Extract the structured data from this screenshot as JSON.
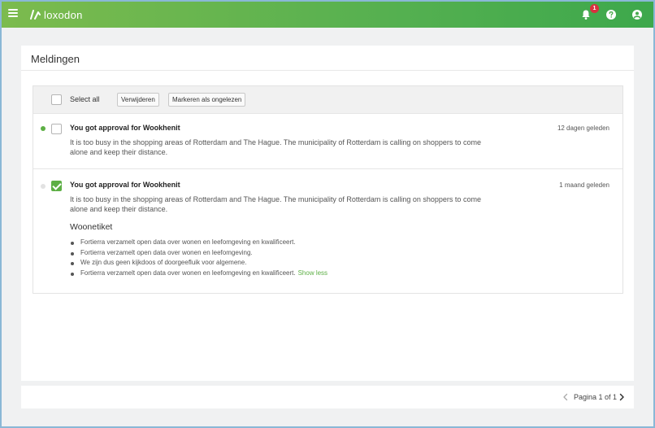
{
  "app": {
    "logo_text": "loxodon"
  },
  "topbar": {
    "notification_count": "1",
    "icons": [
      "menu-icon",
      "bell-icon",
      "help-icon",
      "user-icon"
    ]
  },
  "page": {
    "title": "Meldingen"
  },
  "toolbar": {
    "select_all_label": "Select all",
    "delete_label": "Verwijderen",
    "mark_unread_label": "Markeren als ongelezen"
  },
  "notifications": [
    {
      "read": false,
      "selected": false,
      "title": "You got approval for Wookhenit",
      "body": "It is too busy in the shopping areas of Rotterdam and The Hague. The municipality of Rotterdam is calling on shoppers to come alone and keep their distance.",
      "time": "12 dagen geleden"
    },
    {
      "read": true,
      "selected": true,
      "title": "You got approval for Wookhenit",
      "body": "It is too busy in the shopping areas of Rotterdam and The Hague. The municipality of Rotterdam is calling on shoppers to come alone and keep their distance.",
      "time": "1 maand geleden",
      "details_title": "Woonetiket",
      "details": [
        "Fortierra verzamelt open data over wonen en leefomgeving en kwalificeert.",
        "Fortierra verzamelt open data over wonen en leefomgeving.",
        "We zijn dus geen kijkdoos of doorgeefluik voor algemene.",
        "Fortierra verzamelt open data over wonen en leefomgeving en kwalificeert."
      ],
      "show_less_label": "Show less"
    }
  ],
  "pagination": {
    "label": "Pagina 1 of 1"
  },
  "colors": {
    "accent": "#5daf45",
    "badge": "#d9303f",
    "header_start": "#7cbb4e",
    "header_end": "#3da84c"
  }
}
